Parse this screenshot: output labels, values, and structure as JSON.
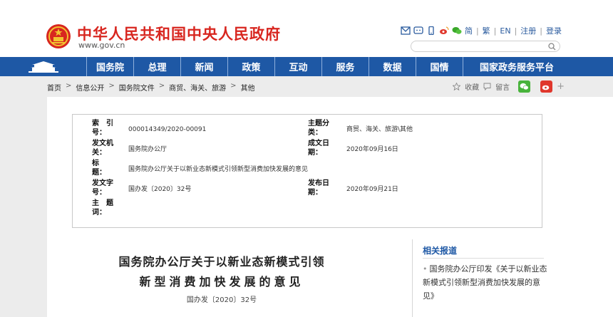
{
  "header": {
    "site_title": "中华人民共和国中央人民政府",
    "site_url": "www.gov.cn",
    "tools": {
      "simplified": "简",
      "traditional": "繁",
      "english": "EN",
      "register": "注册",
      "login": "登录"
    },
    "search_placeholder": ""
  },
  "nav": {
    "items": [
      {
        "label": "国务院"
      },
      {
        "label": "总理"
      },
      {
        "label": "新闻"
      },
      {
        "label": "政策"
      },
      {
        "label": "互动"
      },
      {
        "label": "服务"
      },
      {
        "label": "数据"
      },
      {
        "label": "国情"
      },
      {
        "label": "国家政务服务平台"
      }
    ]
  },
  "breadcrumb": {
    "items": [
      "首页",
      "信息公开",
      "国务院文件",
      "商贸、海关、旅游",
      "其他"
    ],
    "separator": ">"
  },
  "share": {
    "favorite": "收藏",
    "comment": "留言",
    "plus": "+"
  },
  "meta": {
    "index_label_1": "索　引",
    "index_label_2": "号：",
    "index_value": "000014349/2020-00091",
    "topic_label_1": "主题分",
    "topic_label_2": "类：",
    "topic_value": "商贸、海关、旅游\\其他",
    "issuer_label_1": "发文机",
    "issuer_label_2": "关：",
    "issuer_value": "国务院办公厅",
    "created_label_1": "成文日",
    "created_label_2": "期：",
    "created_value": "2020年09月16日",
    "title_label_1": "标　",
    "title_label_2": "题：",
    "title_value": "国务院办公厅关于以新业态新模式引领新型消费加快发展的意见",
    "docno_label_1": "发文字",
    "docno_label_2": "号：",
    "docno_value": "国办发〔2020〕32号",
    "published_label_1": "发布日",
    "published_label_2": "期：",
    "published_value": "2020年09月21日",
    "keywords_label_1": "主　题",
    "keywords_label_2": "词：",
    "keywords_value": ""
  },
  "article": {
    "title_line1": "国务院办公厅关于以新业态新模式引领",
    "title_line2": "新型消费加快发展的意见",
    "doc_number": "国办发〔2020〕32号"
  },
  "related": {
    "title": "相关报道",
    "items": [
      {
        "text": "国务院办公厅印发《关于以新业态新模式引领新型消费加快发展的意见》"
      }
    ]
  },
  "colors": {
    "brand_red": "#d8261f",
    "nav_blue": "#1e58a5",
    "link_blue": "#2a5b9e"
  }
}
